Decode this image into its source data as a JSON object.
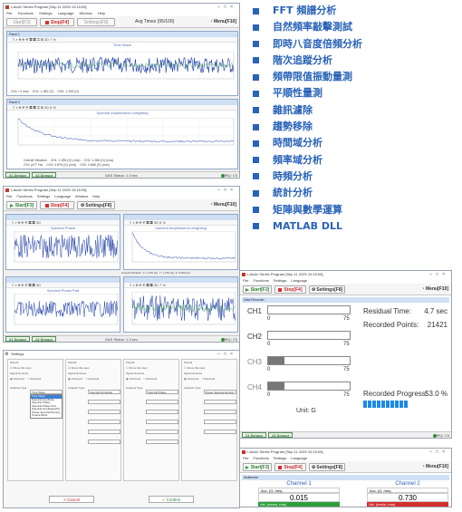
{
  "app": {
    "title": "I-AnaV Series Program [Sep 11 2025 10:15:05]",
    "menu": [
      "File",
      "Functions",
      "Settings",
      "Language",
      "Window",
      "Help"
    ],
    "start_label": "Start[F3]",
    "stop_label": "Stop[F4]",
    "settings_label": "Settings[F8]",
    "menu_label": "Menu[F10]"
  },
  "colors": {
    "accent": "#2a63b8",
    "start": "#2e9e3a",
    "stop": "#d32f2f",
    "signal": "#1f3ea8",
    "progress": "#1e88e5"
  },
  "screen1": {
    "avg_label": "Avg Times (95/100)",
    "panel1_header": "Panel 1",
    "panel1_title": "Time Wave",
    "panel1_readouts": [
      "CH1 / X max",
      "CH1: 1.982 (G)",
      "CH2: 1.295 (G)"
    ],
    "panel2_header": "Panel 2",
    "panel2_title": "Spectral Amplitude/no weighting",
    "panel2_readouts": [
      "Overall Vibration",
      "CH1: 1.285 (G) (rms)",
      "CH2: 1.286 (G) (rms)",
      "CH1 (477 Hz)",
      "CH1: 0.876 (G) (rms)",
      "CH2: 0.886 (G) (rms)"
    ],
    "tab1": "#1 Sensor",
    "tab2": "#2 Sensor",
    "status_mid": "DAS Status: 1.3 sec",
    "device": "CIRQ: C5"
  },
  "screen2": {
    "panel1_title": "Spectral Phase",
    "panel2_title": "Spectral Amplitude/no weighting",
    "panel3_title": "Spectral Phase Pad",
    "readouts": [
      "Overall Vibration",
      "X: 1.276 (G)",
      "Y: 1.276 (G)",
      "Z: 0.000 (G)"
    ],
    "tab1": "#1 Sensor",
    "tab2": "#2 Sensor",
    "status_mid": "DAS Status: 1.3 sec",
    "device": "CIRQ: C5"
  },
  "recorder": {
    "panel_header": "Data Recorder",
    "rows": [
      {
        "label": "CH1",
        "min": "0",
        "max": "75",
        "fill": 0.0,
        "active": true
      },
      {
        "label": "CH2",
        "min": "0",
        "max": "75",
        "fill": 0.0,
        "active": true
      },
      {
        "label": "CH3",
        "min": "0",
        "max": "75",
        "fill": 0.2,
        "active": false
      },
      {
        "label": "CH4",
        "min": "0",
        "max": "75",
        "fill": 0.2,
        "active": false
      }
    ],
    "unit": "Unit: G",
    "residual_label": "Residual Time:",
    "residual_value": "4.7 sec",
    "points_label": "Recorded Points:",
    "points_value": "21421",
    "progress_label": "Recorded Progress:",
    "progress_value": "53.0 %",
    "progress": 0.53,
    "tab1": "#1 Sensor",
    "tab2": "#2 Sensor",
    "device": "CIRQ: C5"
  },
  "settings": {
    "title": "Settings",
    "columns": [
      "Panel1",
      "Panel2",
      "Panel3",
      "Panel4"
    ],
    "show_this": "Show this view",
    "signal_sources": "Signal Sources",
    "analysis_type": "Analysis Type",
    "analysis_values": [
      "Time Wave",
      "Spectral Amplitude",
      "Spectral Phase",
      "Power Spectral Density"
    ],
    "dropdown_options": [
      "Time Wave",
      "Spectral Amplitude",
      "Spectral Phase",
      "Spectral Phase Pad",
      "Spectral Amplitude(Wt)",
      "Power Spectral Density",
      "Octave Band"
    ],
    "cancel_label": "Cancel",
    "confirm_label": "Confirm"
  },
  "meter": {
    "panel_header": "Multimeter",
    "ch1_title": "Channel 1",
    "ch2_title": "Channel 2",
    "ch1_label": "Acc. (G, rms)",
    "ch2_label": "Acc. (G, rms)",
    "ch1_value": "0.015",
    "ch2_value": "0.730",
    "ch1_sub": "Vel. (mm/s, rms)",
    "ch2_sub": "Vel. (mm/s, rms)"
  },
  "features": [
    "FFT 頻譜分析",
    "自然頻率敲擊測試",
    "即時八音度倍頻分析",
    "階次追蹤分析",
    "頻帶限值振動量測",
    "平順性量測",
    "雜訊濾除",
    "趨勢移除",
    "時間域分析",
    "頻率域分析",
    "時頻分析",
    "統計分析",
    "矩陣與數學運算",
    "MATLAB DLL"
  ]
}
